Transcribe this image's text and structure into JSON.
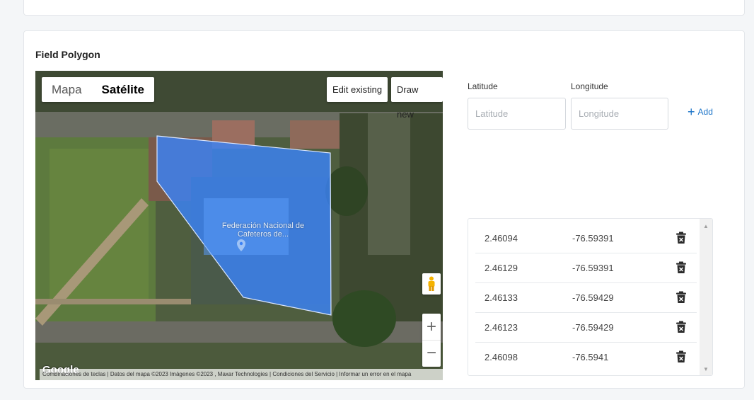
{
  "section": {
    "title": "Field Polygon"
  },
  "map": {
    "type_options": [
      "Mapa",
      "Satélite"
    ],
    "selected_type": "Satélite",
    "edit_existing_label": "Edit existing",
    "draw_new_label": "Draw new",
    "place_label": "Federación Nacional de Cafeteros de...",
    "zoom_in": "+",
    "zoom_out": "−",
    "logo": "Google",
    "attribution": "Combinaciones de teclas | Datos del mapa ©2023 Imágenes ©2023 , Maxar Technologies | Condiciones del Servicio | Informar un error en el mapa"
  },
  "form": {
    "latitude_label": "Latitude",
    "latitude_placeholder": "Latitude",
    "longitude_label": "Longitude",
    "longitude_placeholder": "Longitude",
    "add_label": "Add"
  },
  "coordinates": [
    {
      "lat": "2.46094",
      "lng": "-76.59391"
    },
    {
      "lat": "2.46129",
      "lng": "-76.59391"
    },
    {
      "lat": "2.46133",
      "lng": "-76.59429"
    },
    {
      "lat": "2.46123",
      "lng": "-76.59429"
    },
    {
      "lat": "2.46098",
      "lng": "-76.5941"
    }
  ],
  "colors": {
    "accent": "#1a73c8",
    "polygon_fill": "#3b82f6",
    "polygon_stroke": "#dbe7ff"
  },
  "icons": {
    "delete": "trash-icon",
    "pegman": "pegman-icon",
    "add": "plus-icon"
  }
}
